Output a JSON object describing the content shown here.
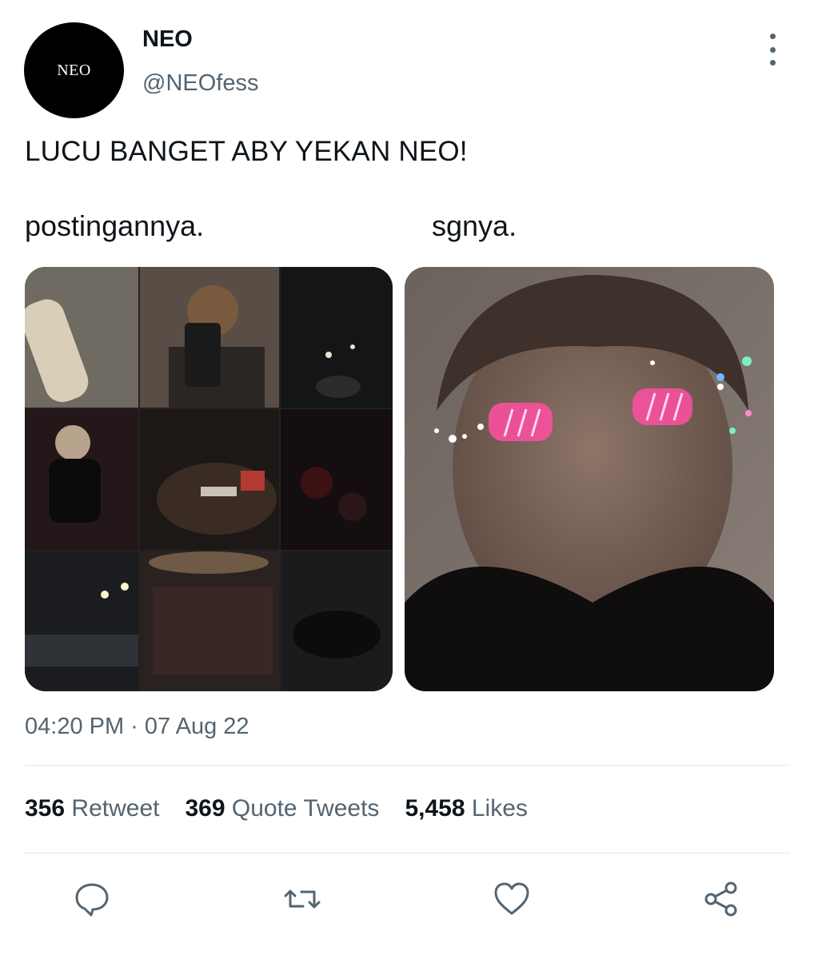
{
  "account": {
    "name": "NEO",
    "handle": "@NEOfess",
    "avatar_text": "NEO"
  },
  "tweet": {
    "text": "LUCU BANGET ABY YEKAN NEO!",
    "caption_left": "postingannya.",
    "caption_right": "sgnya.",
    "timestamp": "04:20 PM · 07 Aug 22"
  },
  "stats": {
    "retweets": {
      "count": "356",
      "label": "Retweet"
    },
    "quotes": {
      "count": "369",
      "label": "Quote Tweets"
    },
    "likes": {
      "count": "5,458",
      "label": "Likes"
    }
  },
  "actions": [
    {
      "name": "reply",
      "icon": "reply-icon"
    },
    {
      "name": "retweet",
      "icon": "retweet-icon"
    },
    {
      "name": "like",
      "icon": "heart-icon"
    },
    {
      "name": "share",
      "icon": "share-icon"
    }
  ],
  "colors": {
    "text": "#0f1419",
    "secondary": "#536471",
    "divider": "#e1e5e8",
    "blush": "#ff4fa3"
  }
}
